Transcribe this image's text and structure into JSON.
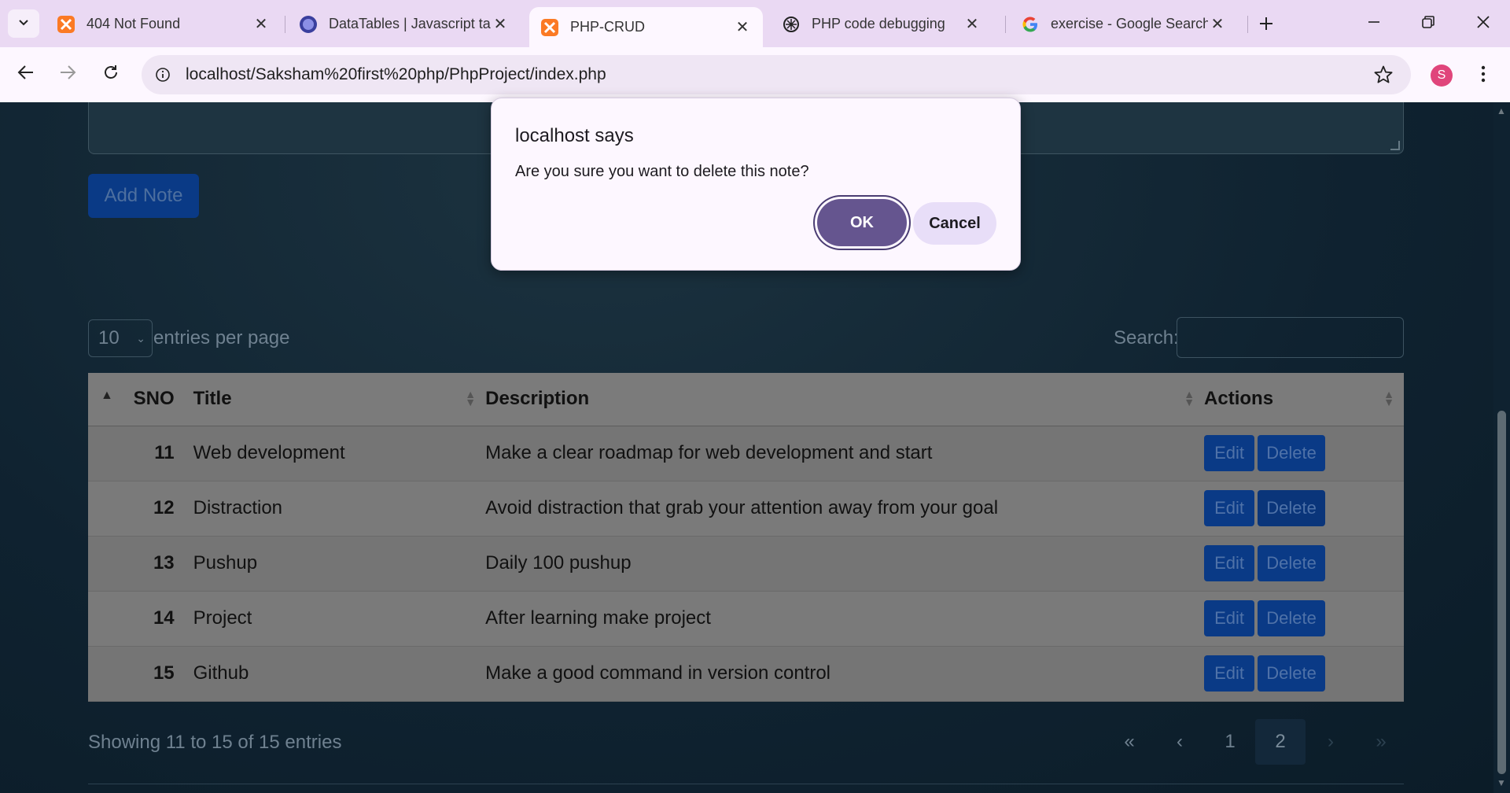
{
  "browser": {
    "tabs": [
      {
        "title": "404 Not Found",
        "favicon": "xampp-icon"
      },
      {
        "title": "DataTables | Javascript ta",
        "favicon": "datatables-icon"
      },
      {
        "title": "PHP-CRUD",
        "favicon": "xampp-icon",
        "active": true
      },
      {
        "title": "PHP code debugging",
        "favicon": "chatgpt-icon"
      },
      {
        "title": "exercise - Google Search",
        "favicon": "google-icon"
      }
    ],
    "url": "localhost/Saksham%20first%20php/PhpProject/index.php",
    "profile_initial": "S"
  },
  "page": {
    "add_note_label": "Add Note",
    "entries_value": "10",
    "entries_label": "entries per page",
    "search_label": "Search:",
    "table": {
      "headers": {
        "sno": "SNO",
        "title": "Title",
        "description": "Description",
        "actions": "Actions"
      },
      "rows": [
        {
          "sno": "11",
          "title": "Web development",
          "description": "Make a clear roadmap for web development and start"
        },
        {
          "sno": "12",
          "title": "Distraction",
          "description": "Avoid distraction that grab your attention away from your goal"
        },
        {
          "sno": "13",
          "title": "Pushup",
          "description": "Daily 100 pushup"
        },
        {
          "sno": "14",
          "title": "Project",
          "description": "After learning make project"
        },
        {
          "sno": "15",
          "title": "Github",
          "description": "Make a good command in version control"
        }
      ],
      "edit_label": "Edit",
      "delete_label": "Delete"
    },
    "info": "Showing 11 to 15 of 15 entries",
    "pager": {
      "first": "«",
      "prev": "‹",
      "pages": [
        "1",
        "2"
      ],
      "current": "2",
      "next": "›",
      "last": "»"
    }
  },
  "dialog": {
    "title": "localhost says",
    "message": "Are you sure you want to delete this note?",
    "ok_label": "OK",
    "cancel_label": "Cancel"
  },
  "colors": {
    "page_bg": "#0f2230",
    "primary_button": "#0a3a86",
    "dialog_ok": "#65558f",
    "dialog_cancel": "#e8def8",
    "table_bg": "#7a7a7a"
  }
}
